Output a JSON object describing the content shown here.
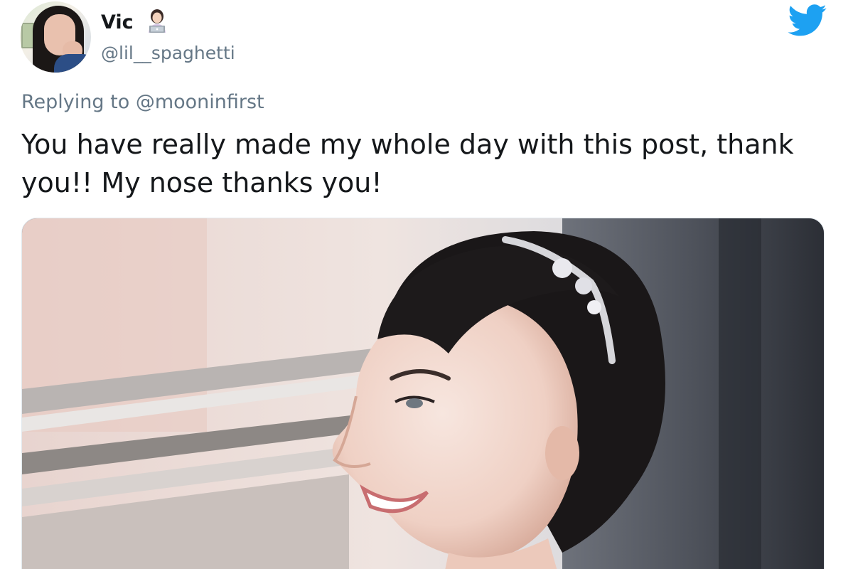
{
  "tweet": {
    "display_name": "Vic",
    "name_emoji": "woman-technologist-emoji",
    "handle": "@lil__spaghetti",
    "reply_prefix": "Replying to",
    "reply_to": "@mooninfirst",
    "text": "You have really made my whole day with this post, thank you!! My nose thanks you!",
    "platform_icon": "twitter-bird-icon",
    "accent_color": "#1da1f2",
    "media_description_icon": "photo"
  }
}
